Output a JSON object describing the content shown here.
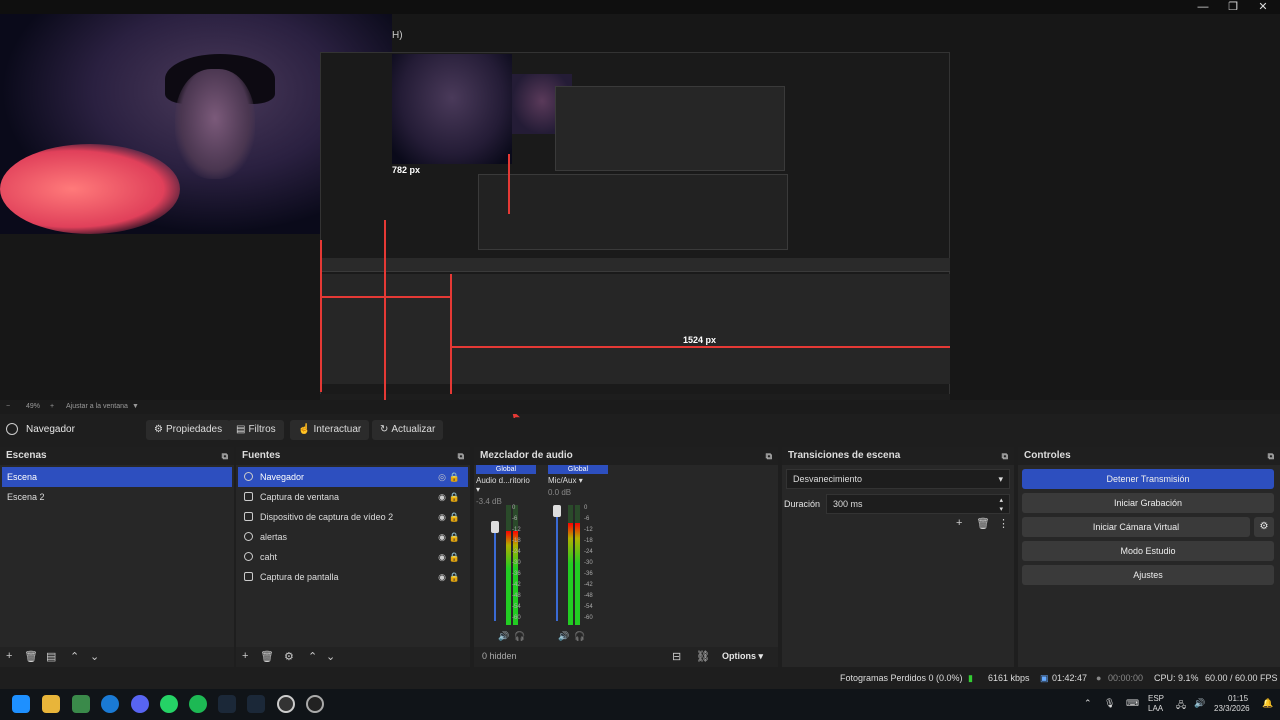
{
  "window": {
    "title_fragment": "H)",
    "controls": [
      "—",
      "❐",
      "✕"
    ]
  },
  "preview": {
    "label_782": "782 px",
    "label_1524": "1524 px",
    "zoom_text": "49%",
    "zoom_mode": "Ajustar a la ventana"
  },
  "toolbar": {
    "source_name": "Navegador",
    "properties": "Propiedades",
    "filters": "Filtros",
    "interact": "Interactuar",
    "refresh": "Actualizar"
  },
  "scenes": {
    "title": "Escenas",
    "items": [
      {
        "label": "Escena",
        "selected": true
      },
      {
        "label": "Escena 2",
        "selected": false
      }
    ]
  },
  "sources": {
    "title": "Fuentes",
    "items": [
      {
        "label": "Navegador",
        "icon": "globe-icon",
        "selected": true
      },
      {
        "label": "Captura de ventana",
        "icon": "window-icon",
        "selected": false
      },
      {
        "label": "Dispositivo de captura de vídeo 2",
        "icon": "camera-icon",
        "selected": false
      },
      {
        "label": "alertas",
        "icon": "globe-icon",
        "selected": false
      },
      {
        "label": "caht",
        "icon": "globe-icon",
        "selected": false
      },
      {
        "label": "Captura de pantalla",
        "icon": "monitor-icon",
        "selected": false
      }
    ]
  },
  "mixer": {
    "title": "Mezclador de audio",
    "channels": [
      {
        "scope": "Global",
        "name": "Audio d...ritorio",
        "db": "-3.4 dB",
        "level": 0.78
      },
      {
        "scope": "Global",
        "name": "Mic/Aux",
        "db": "0.0 dB",
        "level": 0.85
      }
    ],
    "scale": [
      "0",
      "-6",
      "-12",
      "-18",
      "-24",
      "-30",
      "-36",
      "-42",
      "-48",
      "-54",
      "-60"
    ],
    "hidden_text": "0 hidden",
    "options_label": "Options"
  },
  "transitions": {
    "title": "Transiciones de escena",
    "selected": "Desvanecimiento",
    "duration_label": "Duración",
    "duration_value": "300 ms"
  },
  "controls": {
    "title": "Controles",
    "buttons": [
      {
        "label": "Detener Transmisión",
        "primary": true
      },
      {
        "label": "Iniciar Grabación",
        "primary": false
      },
      {
        "label": "Iniciar Cámara Virtual",
        "primary": false
      },
      {
        "label": "Modo Estudio",
        "primary": false
      },
      {
        "label": "Ajustes",
        "primary": false
      }
    ]
  },
  "status": {
    "dropped": "Fotogramas Perdidos 0 (0.0%)",
    "bitrate": "6161 kbps",
    "stream_time": "01:42:47",
    "rec_time": "00:00:00",
    "cpu": "CPU: 9.1%",
    "fps": "60.00 / 60.00 FPS"
  },
  "taskbar": {
    "lang": "ESP",
    "lang2": "LAA",
    "time": "01:15",
    "date": "23/3/2026"
  },
  "colors": {
    "accent": "#2d4fbf",
    "guide_red": "#e53935"
  }
}
